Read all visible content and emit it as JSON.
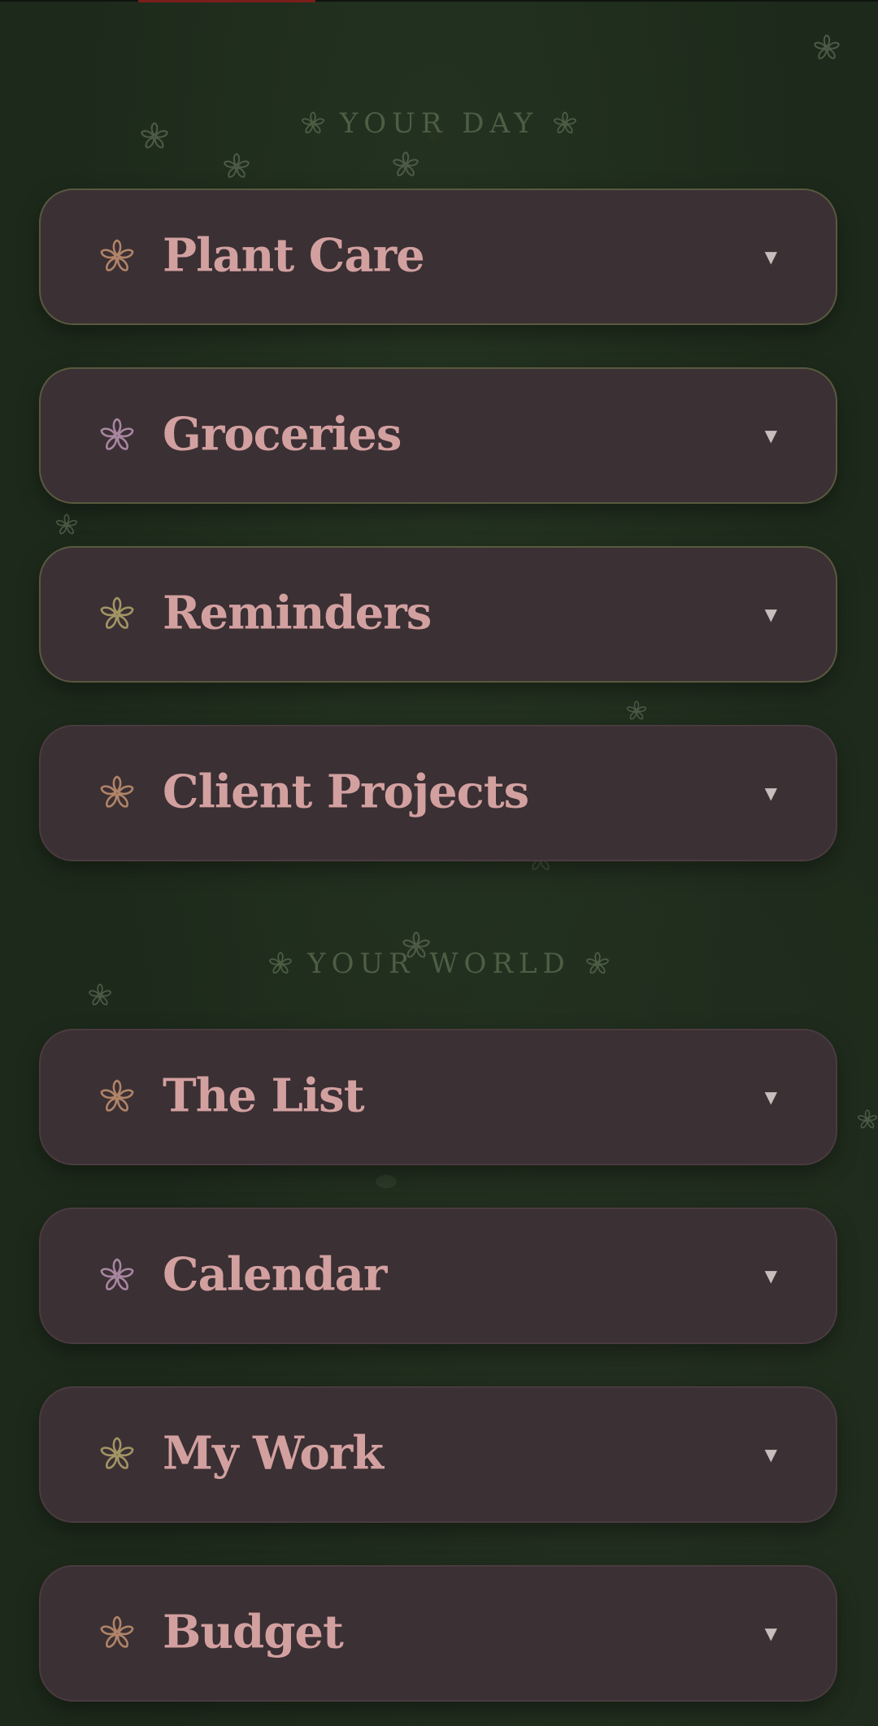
{
  "colors": {
    "background": "#1d2a1b",
    "card": "#3b3034",
    "card_border_active": "#59593f",
    "label": "#d3a0a0",
    "section_title": "#4d5e45",
    "top_accent": "#7a1e1c"
  },
  "sections": [
    {
      "title": "YOUR DAY",
      "items": [
        {
          "label": "Plant Care",
          "icon": "flower-icon",
          "icon_color": "#b08468",
          "chevron": "▼"
        },
        {
          "label": "Groceries",
          "icon": "flower-icon",
          "icon_color": "#a886a0",
          "chevron": "▼"
        },
        {
          "label": "Reminders",
          "icon": "flower-icon",
          "icon_color": "#a39564",
          "chevron": "▼"
        },
        {
          "label": "Client Projects",
          "icon": "flower-icon",
          "icon_color": "#b08468",
          "chevron": "▼"
        }
      ]
    },
    {
      "title": "YOUR WORLD",
      "items": [
        {
          "label": "The List",
          "icon": "flower-icon",
          "icon_color": "#b08468",
          "chevron": "▼"
        },
        {
          "label": "Calendar",
          "icon": "flower-icon",
          "icon_color": "#a886a0",
          "chevron": "▼"
        },
        {
          "label": "My Work",
          "icon": "flower-icon",
          "icon_color": "#a39564",
          "chevron": "▼"
        },
        {
          "label": "Budget",
          "icon": "flower-icon",
          "icon_color": "#b08468",
          "chevron": "▼"
        }
      ]
    }
  ]
}
